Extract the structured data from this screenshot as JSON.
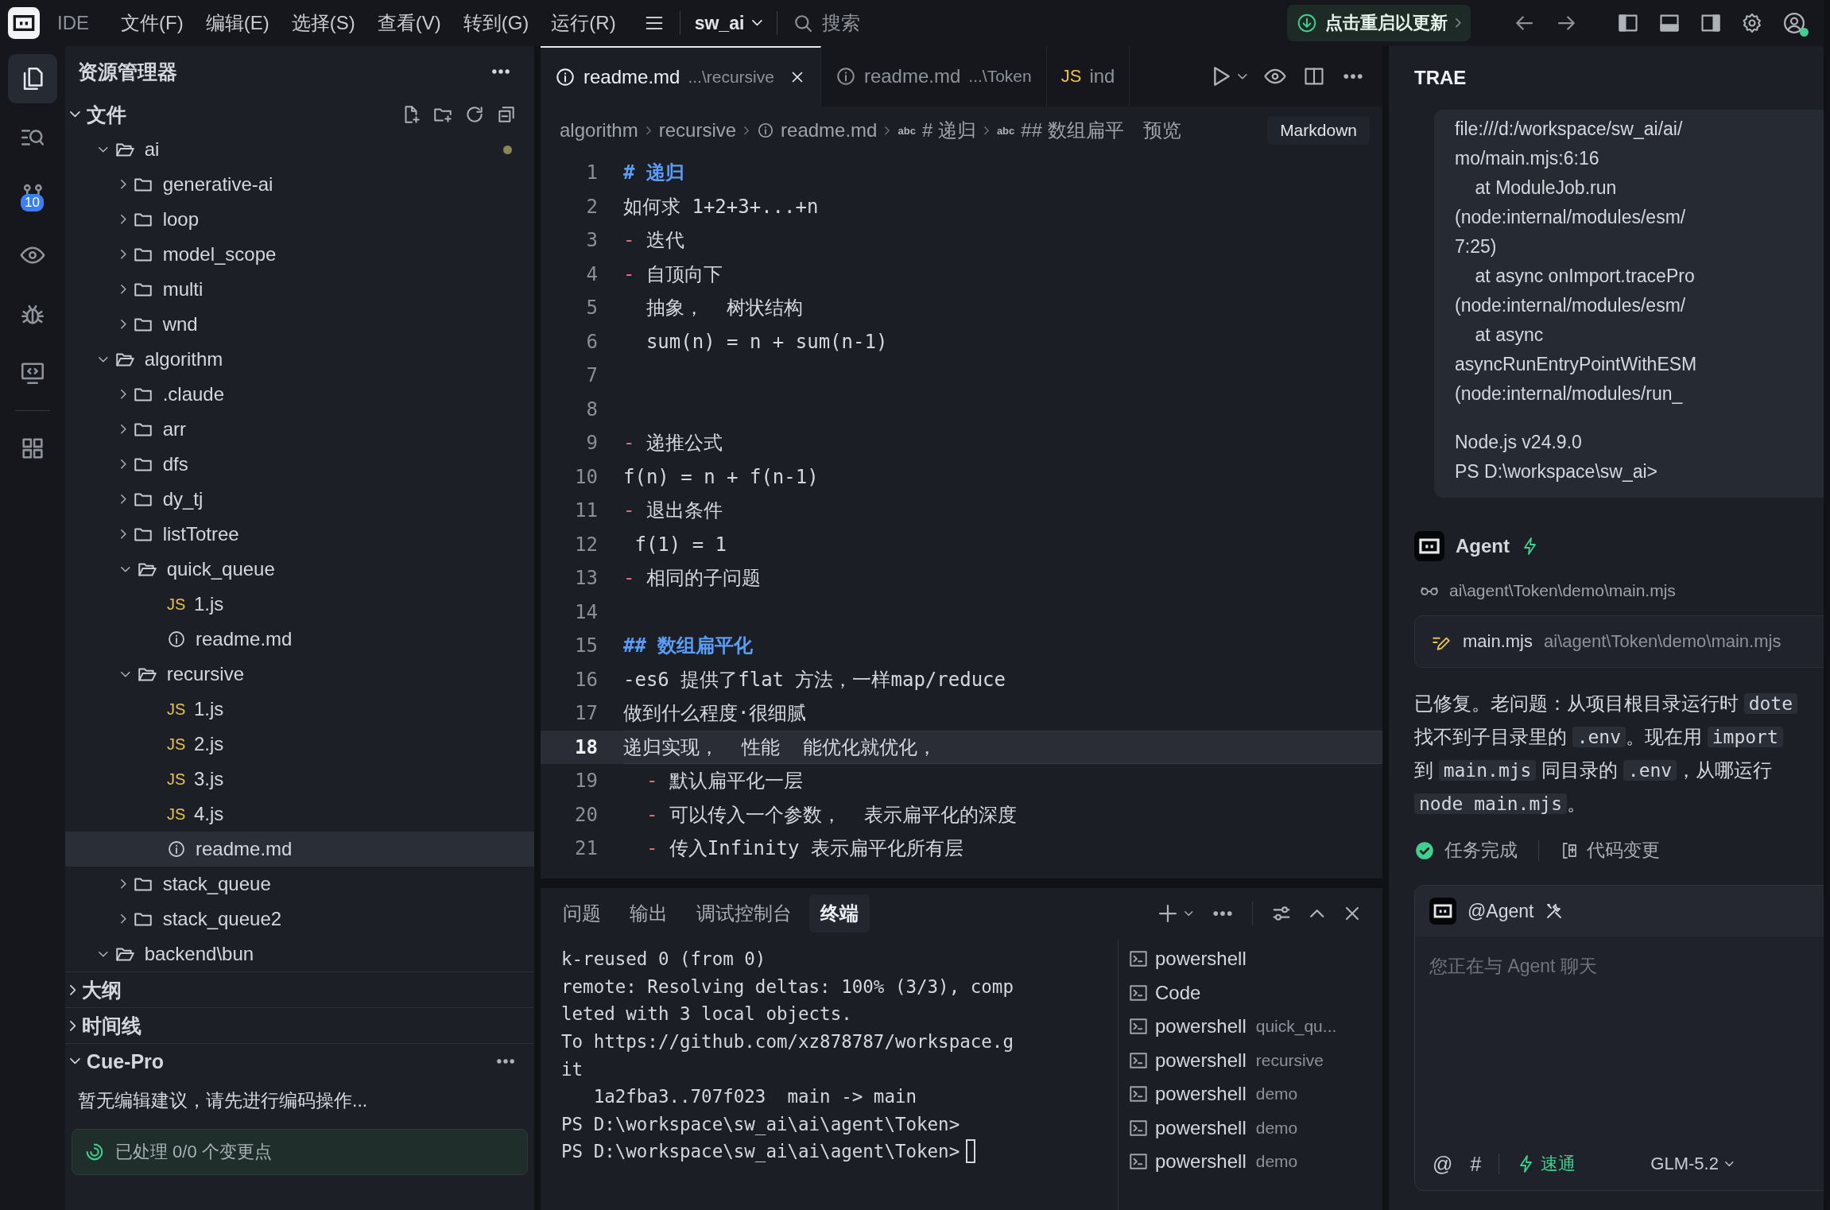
{
  "topbar": {
    "app": "IDE",
    "menus": [
      "文件(F)",
      "编辑(E)",
      "选择(S)",
      "查看(V)",
      "转到(G)",
      "运行(R)"
    ],
    "workspace": "sw_ai",
    "search_placeholder": "搜索",
    "update_button": "点击重启以更新"
  },
  "activity_bar": [
    {
      "kind": "files",
      "selected": true
    },
    {
      "kind": "search",
      "selected": false
    },
    {
      "kind": "source-control",
      "selected": false,
      "badge": "10"
    },
    {
      "kind": "eye",
      "selected": false
    },
    {
      "kind": "debug",
      "selected": false
    },
    {
      "kind": "remote",
      "selected": false
    },
    {
      "kind": "extensions",
      "selected": false
    }
  ],
  "explorer": {
    "title": "资源管理器",
    "sections": [
      {
        "kind": "files",
        "title": "文件",
        "expanded": true,
        "tree": [
          {
            "name": "ai",
            "kind": "folder",
            "expanded": true,
            "selected": false,
            "modified": true,
            "children": [
              {
                "name": "generative-ai",
                "kind": "folder",
                "expanded": false,
                "selected": false,
                "modified": false
              },
              {
                "name": "loop",
                "kind": "folder",
                "expanded": false,
                "selected": false,
                "modified": false
              },
              {
                "name": "model_scope",
                "kind": "folder",
                "expanded": false,
                "selected": false,
                "modified": false
              },
              {
                "name": "multi",
                "kind": "folder",
                "expanded": false,
                "selected": false,
                "modified": false
              },
              {
                "name": "wnd",
                "kind": "folder",
                "expanded": false,
                "selected": false,
                "modified": false
              }
            ]
          },
          {
            "name": "algorithm",
            "kind": "folder",
            "expanded": true,
            "selected": false,
            "modified": false,
            "children": [
              {
                "name": ".claude",
                "kind": "folder",
                "expanded": false,
                "selected": false,
                "modified": false
              },
              {
                "name": "arr",
                "kind": "folder",
                "expanded": false,
                "selected": false,
                "modified": false
              },
              {
                "name": "dfs",
                "kind": "folder",
                "expanded": false,
                "selected": false,
                "modified": false
              },
              {
                "name": "dy_tj",
                "kind": "folder",
                "expanded": false,
                "selected": false,
                "modified": false
              },
              {
                "name": "listTotree",
                "kind": "folder",
                "expanded": false,
                "selected": false,
                "modified": false
              },
              {
                "name": "quick_queue",
                "kind": "folder",
                "expanded": true,
                "selected": false,
                "modified": false,
                "children": [
                  {
                    "name": "1.js",
                    "kind": "js",
                    "badge": "JS",
                    "selected": false,
                    "modified": false
                  },
                  {
                    "name": "readme.md",
                    "kind": "md",
                    "selected": false,
                    "modified": false
                  }
                ]
              },
              {
                "name": "recursive",
                "kind": "folder",
                "expanded": true,
                "selected": false,
                "modified": false,
                "children": [
                  {
                    "name": "1.js",
                    "kind": "js",
                    "badge": "JS",
                    "selected": false,
                    "modified": false
                  },
                  {
                    "name": "2.js",
                    "kind": "js",
                    "badge": "JS",
                    "selected": false,
                    "modified": false
                  },
                  {
                    "name": "3.js",
                    "kind": "js",
                    "badge": "JS",
                    "selected": false,
                    "modified": false
                  },
                  {
                    "name": "4.js",
                    "kind": "js",
                    "badge": "JS",
                    "selected": false,
                    "modified": false
                  },
                  {
                    "name": "readme.md",
                    "kind": "md",
                    "selected": true,
                    "modified": false
                  }
                ]
              },
              {
                "name": "stack_queue",
                "kind": "folder",
                "expanded": false,
                "selected": false,
                "modified": false
              },
              {
                "name": "stack_queue2",
                "kind": "folder",
                "expanded": false,
                "selected": false,
                "modified": false
              }
            ]
          },
          {
            "name": "backend\\bun",
            "kind": "folder",
            "expanded": true,
            "selected": false,
            "modified": false
          }
        ]
      },
      {
        "kind": "plain",
        "title": "大纲",
        "expanded": false
      },
      {
        "kind": "plain",
        "title": "时间线",
        "expanded": false
      },
      {
        "kind": "cue",
        "title": "Cue-Pro",
        "expanded": true,
        "message": "暂无编辑建议，请先进行编码操作...",
        "status": "已处理 0/0 个变更点"
      }
    ]
  },
  "editor": {
    "tabs": [
      {
        "kind": "md",
        "label": "readme.md",
        "path": "...\\recursive",
        "selected": true
      },
      {
        "kind": "md",
        "label": "readme.md",
        "path": "...\\Token",
        "selected": false
      },
      {
        "kind": "js",
        "badge": "JS",
        "label": "ind",
        "selected": false
      }
    ],
    "breadcrumb": [
      {
        "kind": "folder",
        "text": "algorithm"
      },
      {
        "kind": "folder",
        "text": "recursive"
      },
      {
        "kind": "md",
        "text": "readme.md"
      },
      {
        "kind": "symbol",
        "symbol": "abc",
        "text": "# 递归"
      },
      {
        "kind": "symbol",
        "symbol": "abc",
        "text": "## 数组扁平"
      }
    ],
    "preview": "预览",
    "language": "Markdown",
    "lines": [
      {
        "num": "1",
        "kind": "heading",
        "marker": "#",
        "text": "递归",
        "current": false
      },
      {
        "num": "2",
        "kind": "plain",
        "text": "如何求 1+2+3+...+n",
        "current": false
      },
      {
        "num": "3",
        "kind": "bullet",
        "marker": "-",
        "text": "迭代",
        "current": false
      },
      {
        "num": "4",
        "kind": "bullet",
        "marker": "-",
        "text": "自顶向下",
        "current": false
      },
      {
        "num": "5",
        "kind": "plain",
        "text": "  抽象，  树状结构",
        "current": false
      },
      {
        "num": "6",
        "kind": "plain",
        "text": "  sum(n) = n + sum(n-1)",
        "current": false
      },
      {
        "num": "7",
        "kind": "empty",
        "current": false
      },
      {
        "num": "8",
        "kind": "empty",
        "current": false
      },
      {
        "num": "9",
        "kind": "bullet",
        "marker": "-",
        "text": "递推公式",
        "current": false
      },
      {
        "num": "10",
        "kind": "plain",
        "text": "f(n) = n + f(n-1)",
        "current": false
      },
      {
        "num": "11",
        "kind": "bullet",
        "marker": "-",
        "text": "退出条件",
        "current": false
      },
      {
        "num": "12",
        "kind": "plain",
        "text": " f(1) = 1",
        "current": false
      },
      {
        "num": "13",
        "kind": "bullet",
        "marker": "-",
        "text": "相同的子问题",
        "current": false
      },
      {
        "num": "14",
        "kind": "empty",
        "current": false
      },
      {
        "num": "15",
        "kind": "heading",
        "marker": "##",
        "text": "数组扁平化",
        "current": false
      },
      {
        "num": "16",
        "kind": "plain",
        "text": "-es6 提供了flat 方法，一样map/reduce",
        "current": false
      },
      {
        "num": "17",
        "kind": "plain",
        "text": "做到什么程度·很细腻",
        "current": false
      },
      {
        "num": "18",
        "kind": "plain",
        "text": "递归实现，  性能  能优化就优化，",
        "current": true
      },
      {
        "num": "19",
        "kind": "bullet",
        "marker": "  -",
        "text": "默认扁平化一层",
        "current": false
      },
      {
        "num": "20",
        "kind": "bullet",
        "marker": "  -",
        "text": "可以传入一个参数，  表示扁平化的深度",
        "current": false
      },
      {
        "num": "21",
        "kind": "bullet",
        "marker": "  -",
        "text": "传入Infinity 表示扁平化所有层",
        "current": false
      }
    ]
  },
  "panel": {
    "tabs": [
      {
        "label": "问题",
        "selected": false
      },
      {
        "label": "输出",
        "selected": false
      },
      {
        "label": "调试控制台",
        "selected": false
      },
      {
        "label": "终端",
        "selected": true
      }
    ],
    "terminal_lines": [
      "k-reused 0 (from 0)",
      "remote: Resolving deltas: 100% (3/3), comp",
      "leted with 3 local objects.",
      "To https://github.com/xz878787/workspace.g",
      "it",
      "   1a2fba3..707f023  main -> main",
      "PS D:\\workspace\\sw_ai\\ai\\agent\\Token>",
      "PS D:\\workspace\\sw_ai\\ai\\agent\\Token>"
    ],
    "terminals": [
      {
        "name": "powershell"
      },
      {
        "name": "Code"
      },
      {
        "name": "powershell",
        "detail": "quick_qu..."
      },
      {
        "name": "powershell",
        "detail": "recursive"
      },
      {
        "name": "powershell",
        "detail": "demo"
      },
      {
        "name": "powershell",
        "detail": "demo"
      },
      {
        "name": "powershell",
        "detail": "demo"
      }
    ]
  },
  "agent": {
    "title": "TRAE",
    "output_lines": [
      "file:///d:/workspace/sw_ai/ai/",
      "mo/main.mjs:6:16",
      "    at ModuleJob.run",
      "(node:internal/modules/esm/",
      "7:25)",
      "    at async onImport.tracePro",
      "(node:internal/modules/esm/",
      "    at async",
      "asyncRunEntryPointWithESM",
      "(node:internal/modules/run_"
    ],
    "output_footer": [
      "Node.js v24.9.0",
      "PS D:\\workspace\\sw_ai>"
    ],
    "agent_name": "Agent",
    "read_file": "ai\\agent\\Token\\demo\\main.mjs",
    "edit": {
      "file": "main.mjs",
      "path": "ai\\agent\\Token\\demo\\main.mjs"
    },
    "message": [
      [
        {
          "text": "已修复。老问题：从项目根目录运行时 ",
          "code": false
        },
        {
          "text": "dote",
          "code": true
        }
      ],
      [
        {
          "text": "找不到子目录里的 ",
          "code": false
        },
        {
          "text": ".env",
          "code": true
        },
        {
          "text": "。现在用 ",
          "code": false
        },
        {
          "text": "import",
          "code": true
        }
      ],
      [
        {
          "text": "到 ",
          "code": false
        },
        {
          "text": "main.mjs",
          "code": true
        },
        {
          "text": " 同目录的 ",
          "code": false
        },
        {
          "text": ".env",
          "code": true
        },
        {
          "text": "，从哪运行",
          "code": false
        }
      ],
      [
        {
          "text": "node main.mjs",
          "code": true
        },
        {
          "text": "。",
          "code": false
        }
      ]
    ],
    "status": "任务完成",
    "changes": "代码变更",
    "input": {
      "mention": "@Agent",
      "placeholder": "您正在与 Agent 聊天",
      "at": "@",
      "hash": "#",
      "mode": "速通",
      "model": "GLM-5.2"
    }
  }
}
